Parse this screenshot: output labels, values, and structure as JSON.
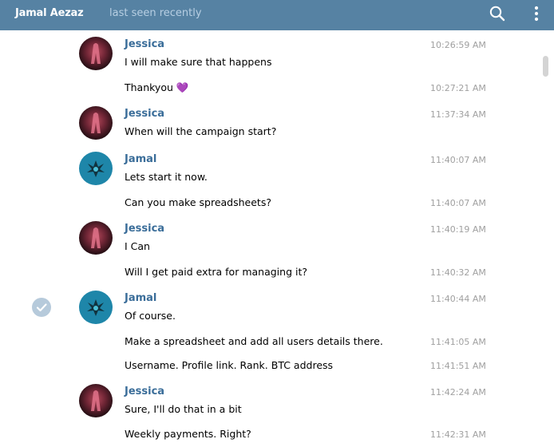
{
  "header": {
    "contact_name": "Jamal Aezaz",
    "contact_status": "last seen recently"
  },
  "colors": {
    "header_bg": "#5682a3",
    "author_name": "#3a6d99",
    "time": "#a0a0a0"
  },
  "messages": [
    {
      "author": "Jessica",
      "text": "I will make sure that happens",
      "time": "10:26:59 AM"
    },
    {
      "author": "",
      "text": "Thankyou 💜",
      "time": "10:27:21 AM"
    },
    {
      "author": "Jessica",
      "text": "When will the campaign start?",
      "time": "11:37:34 AM"
    },
    {
      "author": "Jamal",
      "text": "Lets start it now.",
      "time": "11:40:07 AM"
    },
    {
      "author": "",
      "text": "Can you make spreadsheets?",
      "time": "11:40:07 AM"
    },
    {
      "author": "Jessica",
      "text": "I Can",
      "time": "11:40:19 AM"
    },
    {
      "author": "",
      "text": "Will I get paid extra for managing it?",
      "time": "11:40:32 AM"
    },
    {
      "author": "Jamal",
      "text": "Of course.",
      "time": "11:40:44 AM"
    },
    {
      "author": "",
      "text": "Make a spreadsheet and add all users details there.",
      "time": "11:41:05 AM"
    },
    {
      "author": "",
      "text": "Username. Profile link. Rank. BTC address",
      "time": "11:41:51 AM"
    },
    {
      "author": "Jessica",
      "text": "Sure, I'll do that in a bit",
      "time": "11:42:24 AM"
    },
    {
      "author": "",
      "text": "Weekly payments. Right?",
      "time": "11:42:31 AM"
    }
  ]
}
